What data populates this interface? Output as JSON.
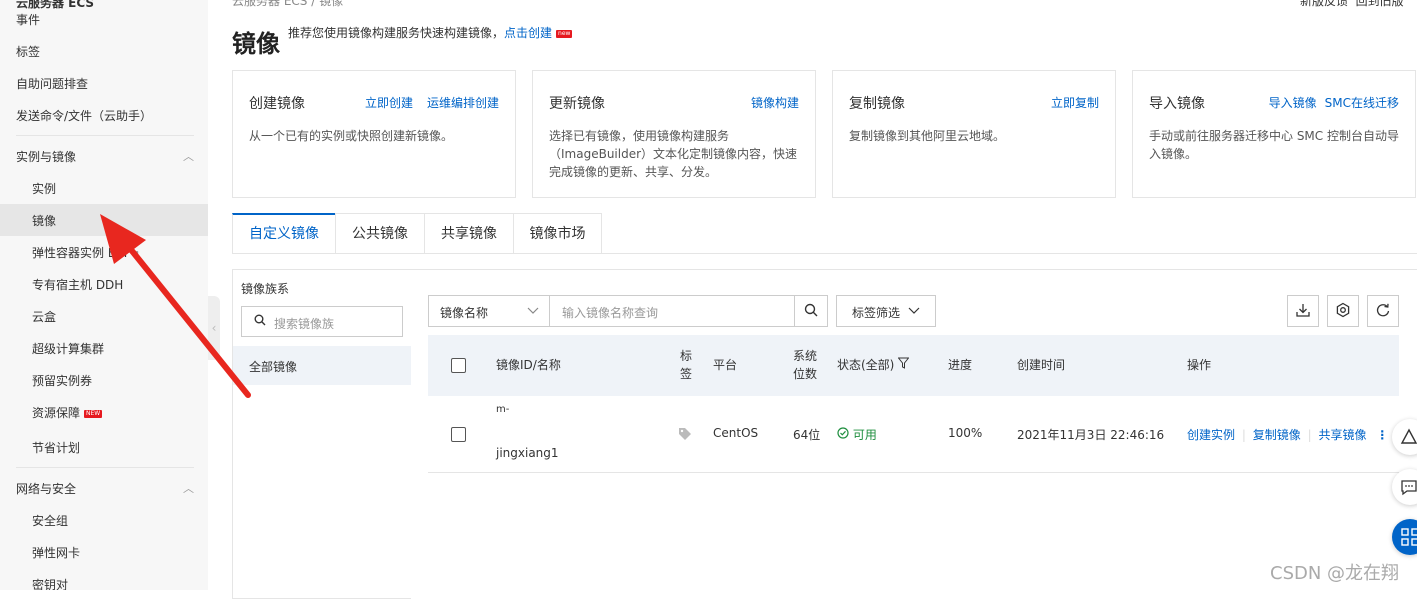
{
  "sidebar": {
    "top_truncated": "云服务器 ECS",
    "items_top": [
      "事件",
      "标签",
      "自助问题排查",
      "发送命令/文件（云助手）"
    ],
    "group_instances": "实例与镜像",
    "instances_items": [
      "实例",
      "镜像",
      "弹性容器实例 ECI",
      "专有宿主机 DDH",
      "云盒",
      "超级计算集群",
      "预留实例券",
      "资源保障",
      "节省计划"
    ],
    "new_badge": "NEW",
    "group_network": "网络与安全",
    "network_items": [
      "安全组",
      "弹性网卡",
      "密钥对"
    ]
  },
  "header": {
    "breadcrumb": "云服务器 ECS  /  镜像",
    "top_right": [
      "新版反馈",
      "回到旧版"
    ],
    "title": "镜像",
    "subtitle": "推荐您使用镜像构建服务快速构建镜像，",
    "subtitle_link": "点击创建",
    "new_badge": "new"
  },
  "cards": [
    {
      "title": "创建镜像",
      "links": [
        "立即创建",
        "运维编排创建"
      ],
      "desc": "从一个已有的实例或快照创建新镜像。"
    },
    {
      "title": "更新镜像",
      "links": [
        "镜像构建"
      ],
      "desc": "选择已有镜像，使用镜像构建服务（ImageBuilder）文本化定制镜像内容，快速完成镜像的更新、共享、分发。"
    },
    {
      "title": "复制镜像",
      "links": [
        "立即复制"
      ],
      "desc": "复制镜像到其他阿里云地域。"
    },
    {
      "title": "导入镜像",
      "links": [
        "导入镜像",
        "SMC在线迁移"
      ],
      "desc": "手动或前往服务器迁移中心 SMC 控制台自动导入镜像。"
    }
  ],
  "tabs": [
    "自定义镜像",
    "公共镜像",
    "共享镜像",
    "镜像市场"
  ],
  "family": {
    "title": "镜像族系",
    "search_placeholder": "搜索镜像族",
    "item_all": "全部镜像"
  },
  "filter": {
    "select_value": "镜像名称",
    "search_placeholder": "输入镜像名称查询",
    "tag_filter": "标签筛选"
  },
  "table": {
    "headers": {
      "id_name": "镜像ID/名称",
      "tag": "标签",
      "platform": "平台",
      "bits": "系统位数",
      "status": "状态(全部)",
      "progress": "进度",
      "created": "创建时间",
      "actions": "操作"
    },
    "rows": [
      {
        "id": "m-",
        "name": "jingxiang1",
        "platform": "CentOS",
        "bits": "64位",
        "status": "可用",
        "progress": "100%",
        "created": "2021年11月3日 22:46:16",
        "actions": [
          "创建实例",
          "复制镜像",
          "共享镜像"
        ]
      }
    ]
  },
  "watermark": "CSDN @龙在翔",
  "colors": {
    "accent": "#0064c8",
    "success": "#1e8e3e",
    "arrow": "#e8271f",
    "new_badge": "#e6191f"
  }
}
